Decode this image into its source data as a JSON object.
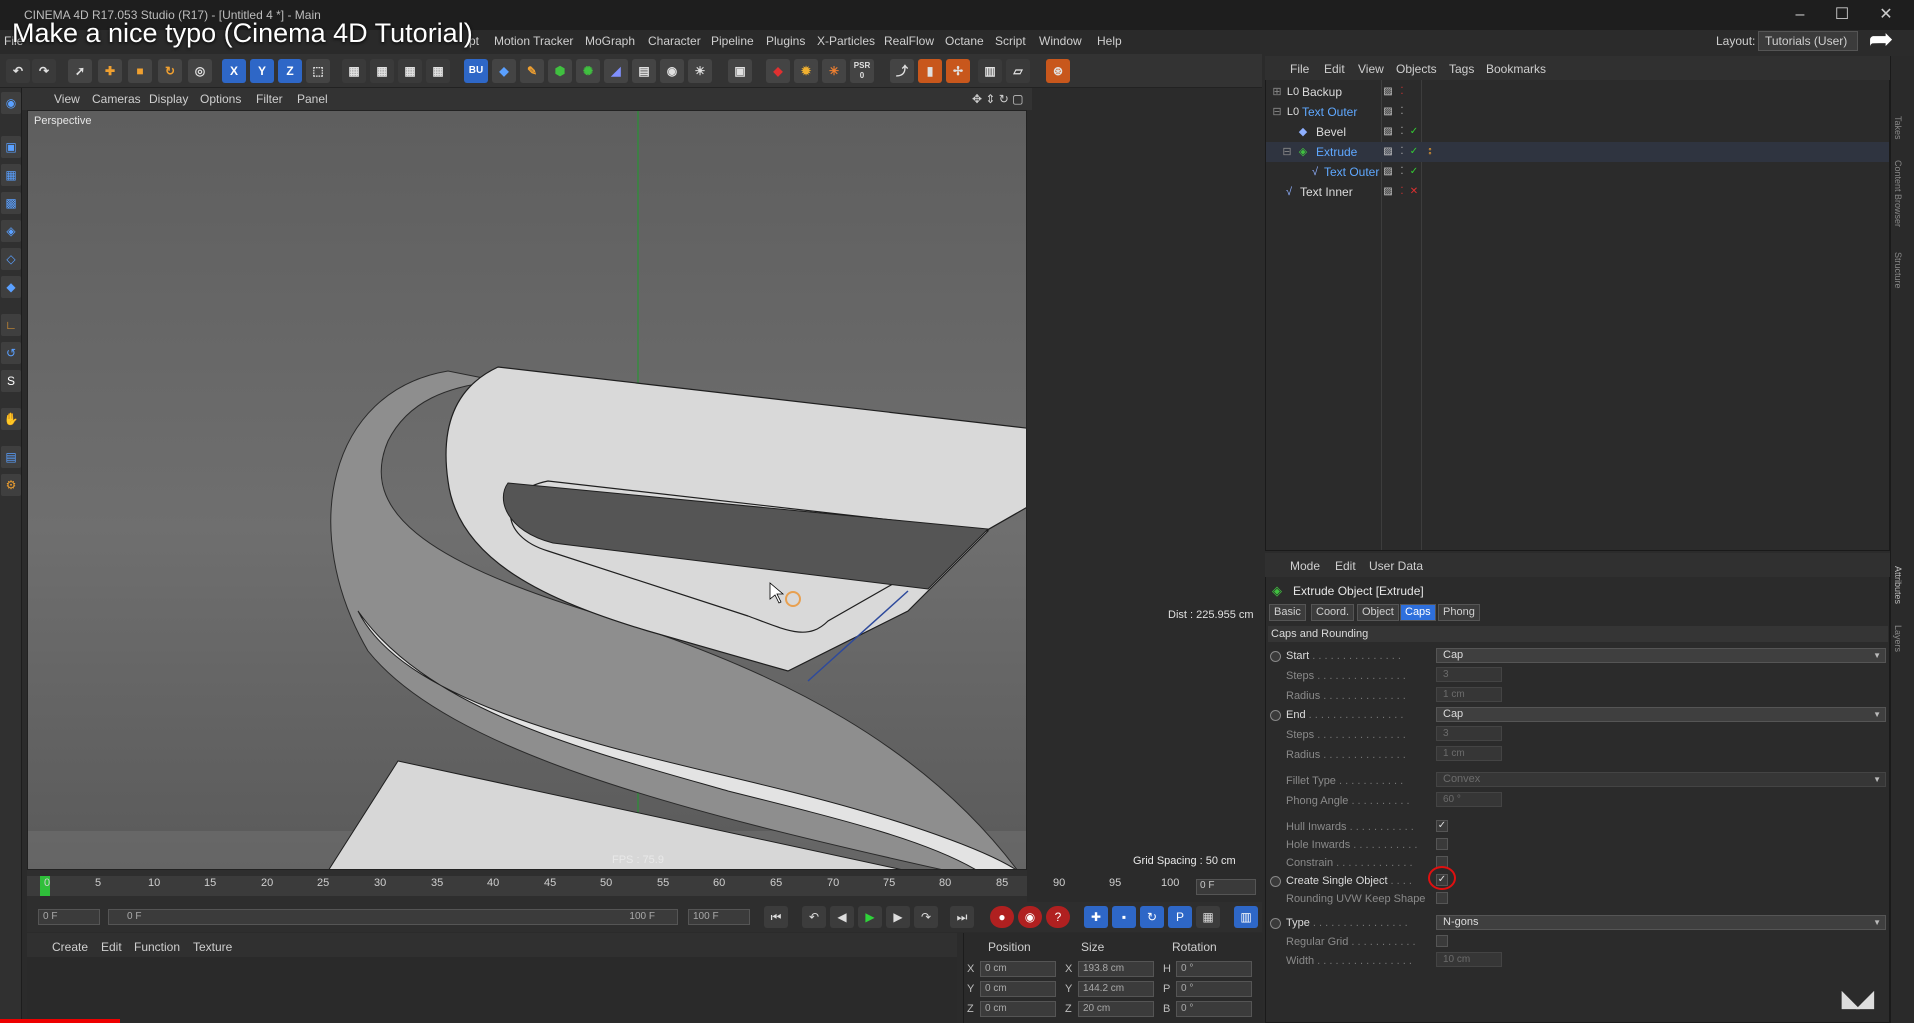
{
  "window": {
    "title": "CINEMA 4D R17.053 Studio (R17) - [Untitled 4 *] - Main",
    "overlay_title": "Make a nice typo (Cinema 4D Tutorial)",
    "layout_label": "Layout:",
    "layout_value": "Tutorials (User)"
  },
  "menubar": [
    "File",
    "Motion Tracker",
    "MoGraph",
    "Character",
    "Pipeline",
    "Plugins",
    "X-Particles",
    "RealFlow",
    "Octane",
    "Script",
    "Window",
    "Help"
  ],
  "menubar_partial": "pt",
  "toolbar": {
    "axis_buttons": [
      "X",
      "Y",
      "Z"
    ],
    "psr_label": "PSR",
    "psr_value": "0"
  },
  "viewport": {
    "menu": [
      "View",
      "Cameras",
      "Display",
      "Options",
      "Filter",
      "Panel"
    ],
    "camera_label": "Perspective",
    "dist_label": "Dist : 225.955 cm",
    "grid_label": "Grid Spacing : 50 cm",
    "fps_label": "FPS : 75.9"
  },
  "timeline": {
    "ticks": [
      "0",
      "5",
      "10",
      "15",
      "20",
      "25",
      "30",
      "35",
      "40",
      "45",
      "50",
      "55",
      "60",
      "65",
      "70",
      "75",
      "80",
      "85",
      "90",
      "95",
      "100"
    ],
    "current_frame": "0 F",
    "start_field": "0 F",
    "range_start": "0 F",
    "range_end": "100 F",
    "end_field": "100 F"
  },
  "material_manager": {
    "menu": [
      "Create",
      "Edit",
      "Function",
      "Texture"
    ]
  },
  "coordinates": {
    "headers": [
      "Position",
      "Size",
      "Rotation"
    ],
    "rows": [
      {
        "axis": "X",
        "pos": "0 cm",
        "size_axis": "X",
        "size": "193.8 cm",
        "rot_axis": "H",
        "rot": "0 °"
      },
      {
        "axis": "Y",
        "pos": "0 cm",
        "size_axis": "Y",
        "size": "144.2 cm",
        "rot_axis": "P",
        "rot": "0 °"
      },
      {
        "axis": "Z",
        "pos": "0 cm",
        "size_axis": "Z",
        "size": "20 cm",
        "rot_axis": "B",
        "rot": "0 °"
      }
    ]
  },
  "object_manager": {
    "menu": [
      "File",
      "Edit",
      "View",
      "Objects",
      "Tags",
      "Bookmarks"
    ],
    "objects": [
      "Backup",
      "Text Outer",
      "Bevel",
      "Extrude",
      "Text Outer",
      "Text Inner"
    ]
  },
  "attributes": {
    "menu": [
      "Mode",
      "Edit",
      "User Data"
    ],
    "title": "Extrude Object [Extrude]",
    "tabs": [
      "Basic",
      "Coord.",
      "Object",
      "Caps",
      "Phong"
    ],
    "section": "Caps and Rounding",
    "start_label": "Start",
    "start_value": "Cap",
    "steps_label": "Steps",
    "steps_value": "3",
    "radius_label": "Radius",
    "radius_value": "1 cm",
    "end_label": "End",
    "end_value": "Cap",
    "fillet_label": "Fillet Type",
    "fillet_value": "Convex",
    "phong_label": "Phong Angle",
    "phong_value": "60 °",
    "hull_label": "Hull Inwards",
    "hole_label": "Hole Inwards",
    "constrain_label": "Constrain",
    "single_label": "Create Single Object",
    "uvw_label": "Rounding UVW Keep Shape",
    "type_label": "Type",
    "type_value": "N-gons",
    "regular_label": "Regular Grid",
    "width_label": "Width",
    "width_value": "10 cm"
  },
  "side_tabs": [
    "Takes",
    "Content Browser",
    "Structure",
    "Attributes",
    "Layers"
  ]
}
